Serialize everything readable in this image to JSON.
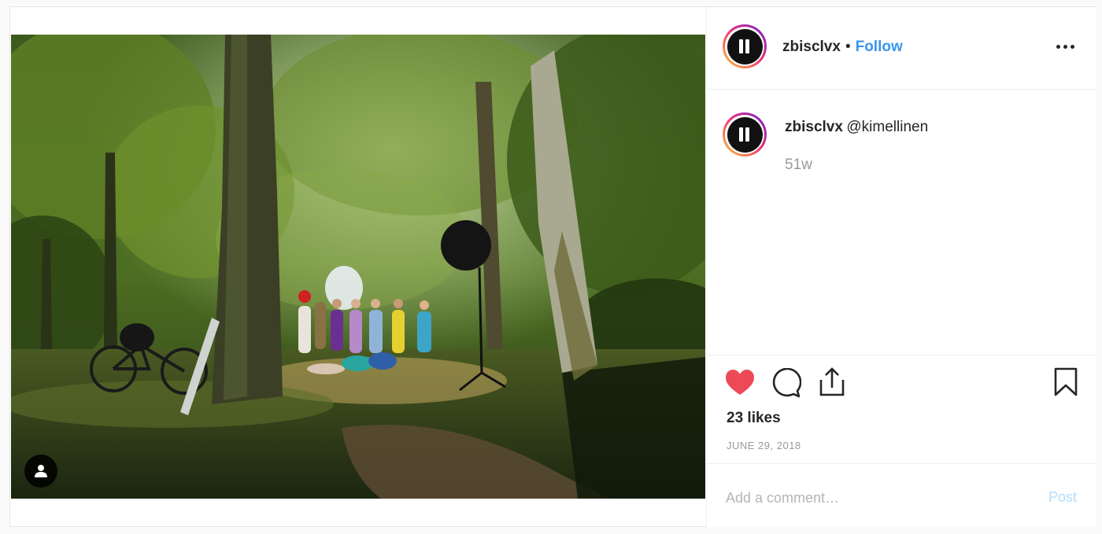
{
  "post": {
    "image_alt": "Group of women in colorful dresses in a sunlit forest clearing with a photography light and a bicycle",
    "tag_icon": "user-icon"
  },
  "header": {
    "username": "zbisclvx",
    "separator": "•",
    "follow_label": "Follow",
    "more_icon": "more-dots-icon"
  },
  "caption": {
    "username": "zbisclvx",
    "text": "@kimellinen",
    "time_ago": "51w"
  },
  "actions": {
    "like_icon": "heart-icon",
    "like_color": "#ed4956",
    "comment_icon": "comment-icon",
    "share_icon": "share-icon",
    "save_icon": "bookmark-icon"
  },
  "likes": "23 likes",
  "date": "JUNE 29, 2018",
  "comment_box": {
    "placeholder": "Add a comment…",
    "post_label": "Post"
  },
  "colors": {
    "accent": "#3897f0",
    "muted": "#999999",
    "post_disabled": "#b2dffc"
  }
}
